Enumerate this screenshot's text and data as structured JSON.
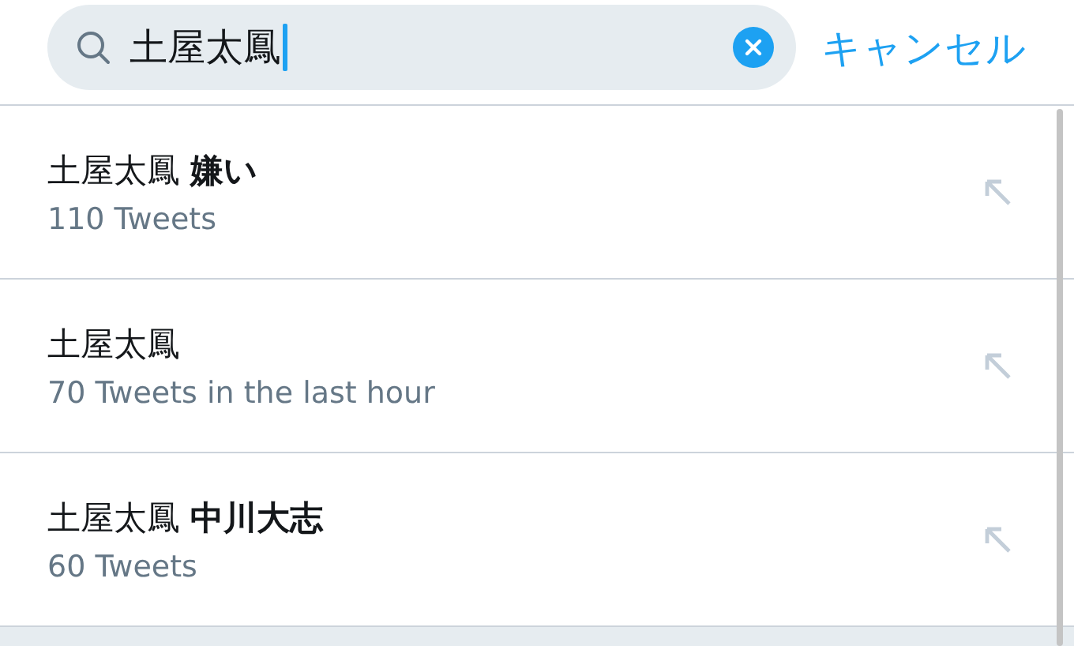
{
  "search": {
    "value": "土屋太鳳",
    "cancel": "キャンセル"
  },
  "suggestions": [
    {
      "query": "土屋太鳳 **嫌い**",
      "count": "110 Tweets"
    },
    {
      "query": "土屋太鳳",
      "count": "70 Tweets in the last hour"
    },
    {
      "query": "土屋太鳳 **中川大志**",
      "count": "60 Tweets"
    }
  ]
}
